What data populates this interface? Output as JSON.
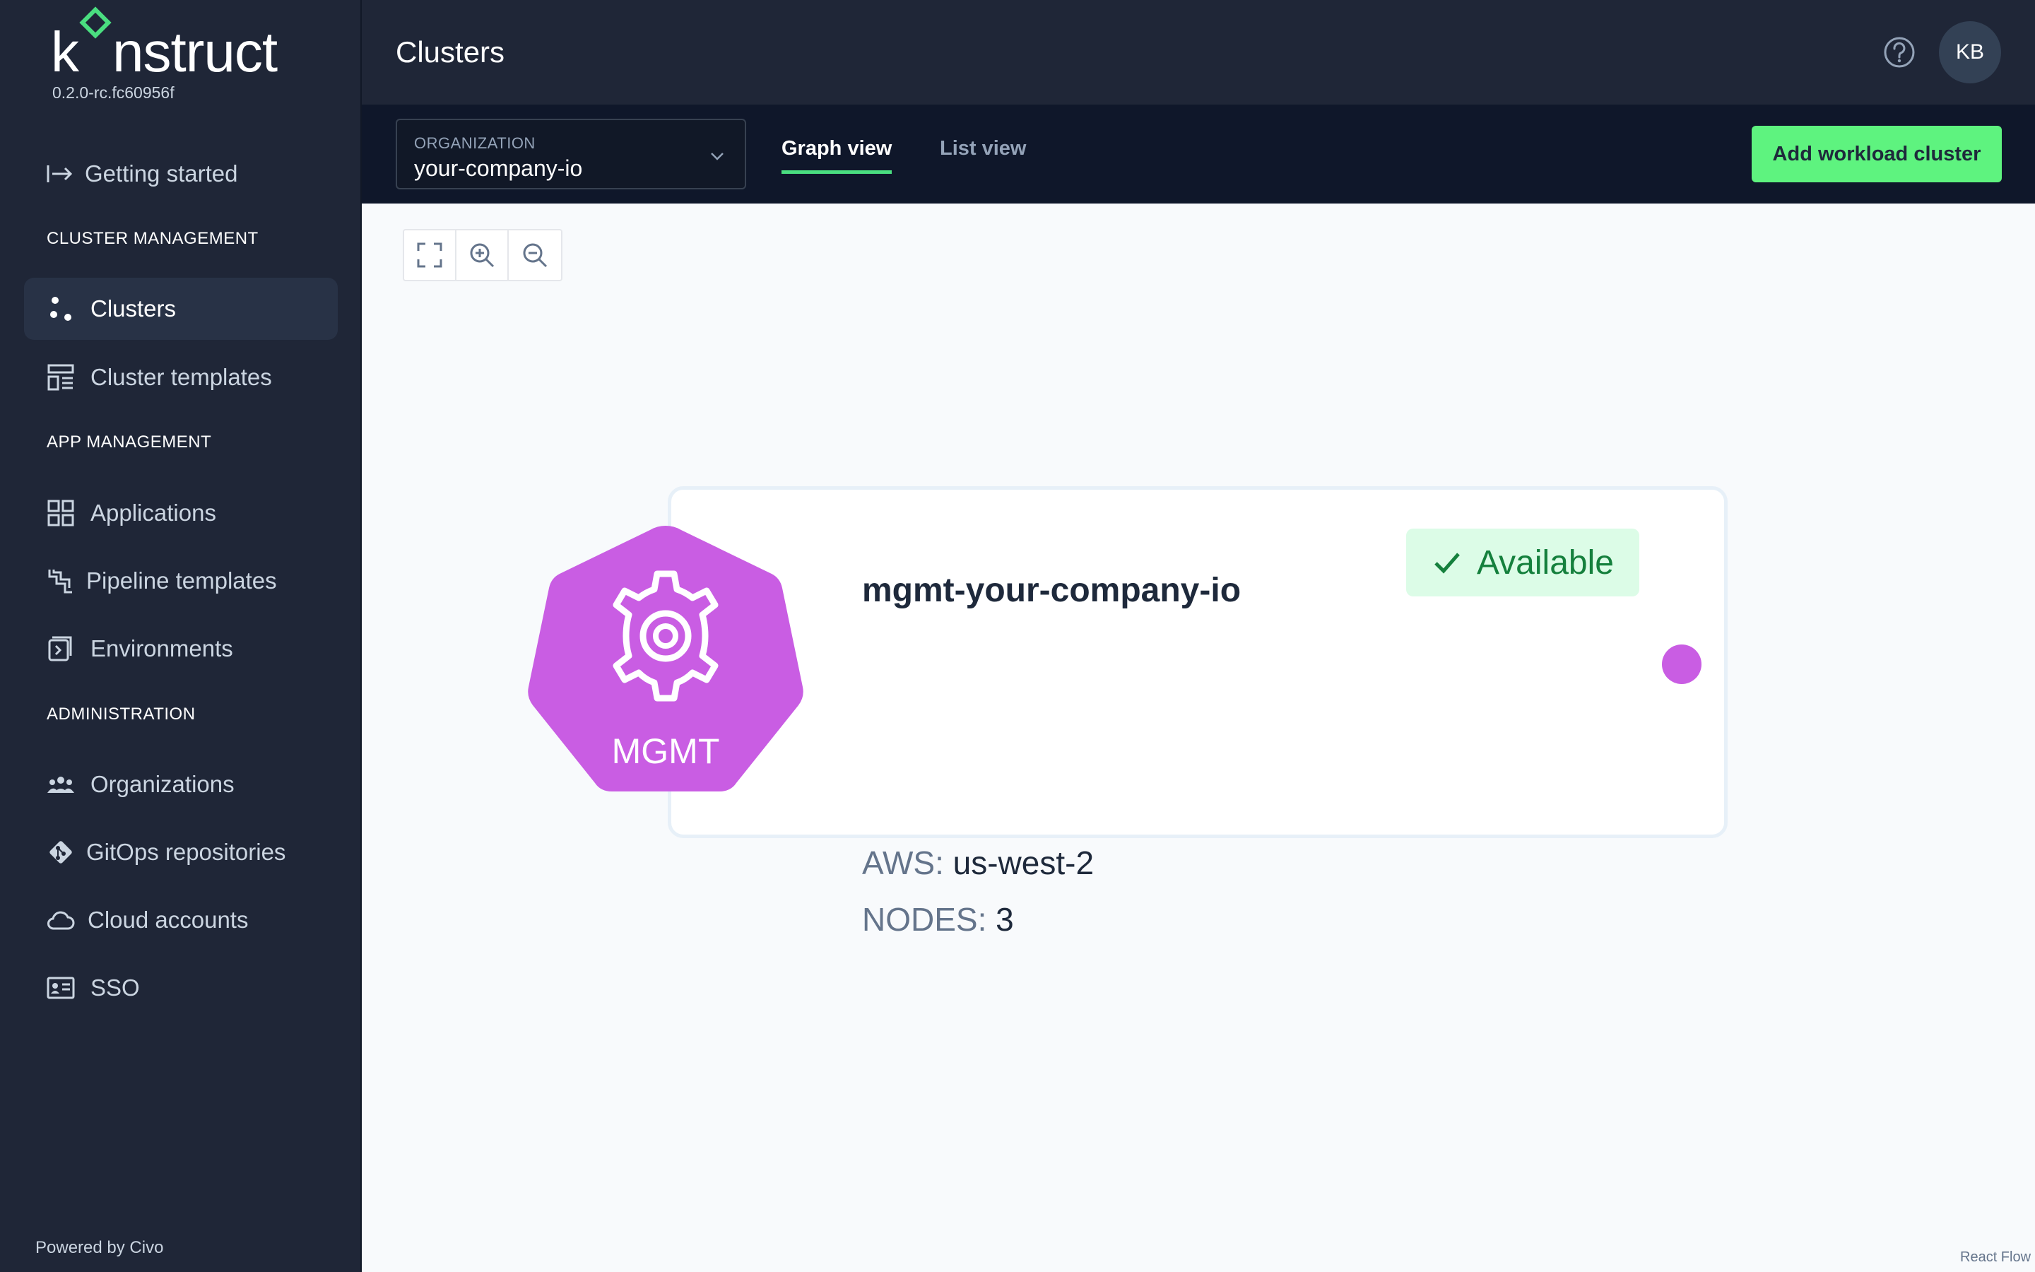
{
  "app": {
    "logo_text_pre": "k",
    "logo_text_post": "nstruct",
    "version": "0.2.0-rc.fc60956f",
    "powered_by": "Powered by Civo"
  },
  "sidebar": {
    "getting_started": "Getting started",
    "sections": {
      "cluster_management": "CLUSTER MANAGEMENT",
      "app_management": "APP MANAGEMENT",
      "administration": "ADMINISTRATION"
    },
    "items": {
      "clusters": "Clusters",
      "cluster_templates": "Cluster templates",
      "applications": "Applications",
      "pipeline_templates": "Pipeline templates",
      "environments": "Environments",
      "organizations": "Organizations",
      "gitops_repositories": "GitOps repositories",
      "cloud_accounts": "Cloud accounts",
      "sso": "SSO"
    }
  },
  "header": {
    "title": "Clusters",
    "avatar_initials": "KB"
  },
  "toolbar": {
    "org_label": "ORGANIZATION",
    "org_value": "your-company-io",
    "tabs": [
      "Graph view",
      "List view"
    ],
    "active_tab": "Graph view",
    "add_button": "Add workload cluster"
  },
  "canvas": {
    "node": {
      "badge_text": "MGMT",
      "name": "mgmt-your-company-io",
      "provider_label": "AWS:",
      "provider_value": "us-west-2",
      "nodes_label": "NODES:",
      "nodes_value": "3",
      "status": "Available"
    },
    "attribution": "React Flow"
  },
  "colors": {
    "sidebar_bg": "#1f2637",
    "toolbar_bg": "#0f172a",
    "accent_green": "#5ef37f",
    "mgmt_purple": "#c95de3",
    "status_green_bg": "#dcfce7",
    "status_green_text": "#15803d"
  }
}
